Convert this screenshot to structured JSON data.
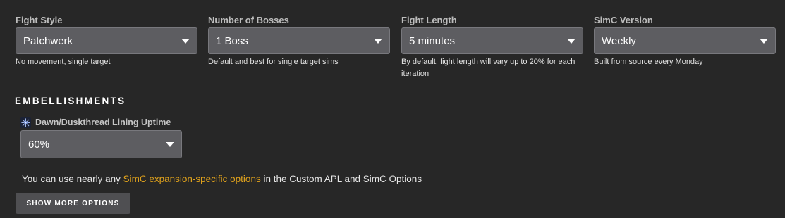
{
  "options": [
    {
      "label": "Fight Style",
      "value": "Patchwerk",
      "help": "No movement, single target"
    },
    {
      "label": "Number of Bosses",
      "value": "1 Boss",
      "help": "Default and best for single target sims"
    },
    {
      "label": "Fight Length",
      "value": "5 minutes",
      "help": "By default, fight length will vary up to 20% for each iteration"
    },
    {
      "label": "SimC Version",
      "value": "Weekly",
      "help": "Built from source every Monday"
    }
  ],
  "embellishments": {
    "heading": "EMBELLISHMENTS",
    "items": [
      {
        "icon": "dawn-duskthread-lining-icon",
        "label": "Dawn/Duskthread Lining Uptime",
        "value": "60%"
      }
    ]
  },
  "info": {
    "text_before": "You can use nearly any ",
    "link_text": "SimC expansion-specific options",
    "text_after": " in the Custom APL and SimC Options"
  },
  "more_button_label": "SHOW MORE OPTIONS",
  "colors": {
    "background": "#272727",
    "select_bg": "#5d5d61",
    "link": "#e0a21c",
    "button_bg": "#4f4f52"
  }
}
